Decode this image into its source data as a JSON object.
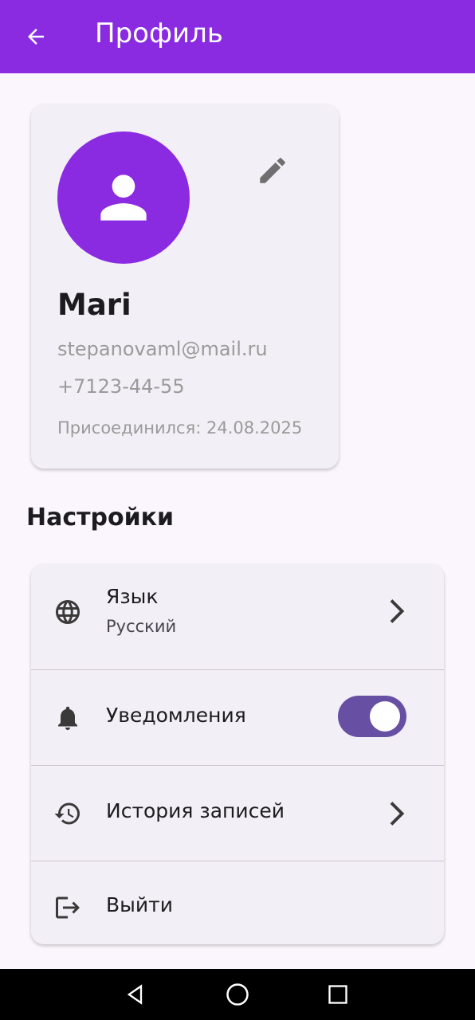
{
  "appbar": {
    "title": "Профиль",
    "color": "#8a2be2"
  },
  "profile": {
    "name": "Mari",
    "email": "stepanovaml@mail.ru",
    "phone": "+7123-44-55",
    "joined": "Присоединился: 24.08.2025"
  },
  "settings": {
    "title": "Настройки",
    "language": {
      "label": "Язык",
      "value": "Русский"
    },
    "notifications": {
      "label": "Уведомления",
      "enabled": true
    },
    "history": {
      "label": "История записей"
    },
    "logout": {
      "label": "Выйти"
    }
  },
  "icons": {
    "back": "arrow-back-icon",
    "avatar": "person-icon",
    "edit": "pencil-icon",
    "language": "globe-icon",
    "notifications": "bell-icon",
    "history": "history-icon",
    "logout": "logout-icon",
    "chevron": "chevron-right-icon"
  },
  "colors": {
    "accent": "#8a2be2",
    "switch_track": "#6750a4",
    "card": "#f3eff6",
    "background": "#fbf6fd"
  }
}
